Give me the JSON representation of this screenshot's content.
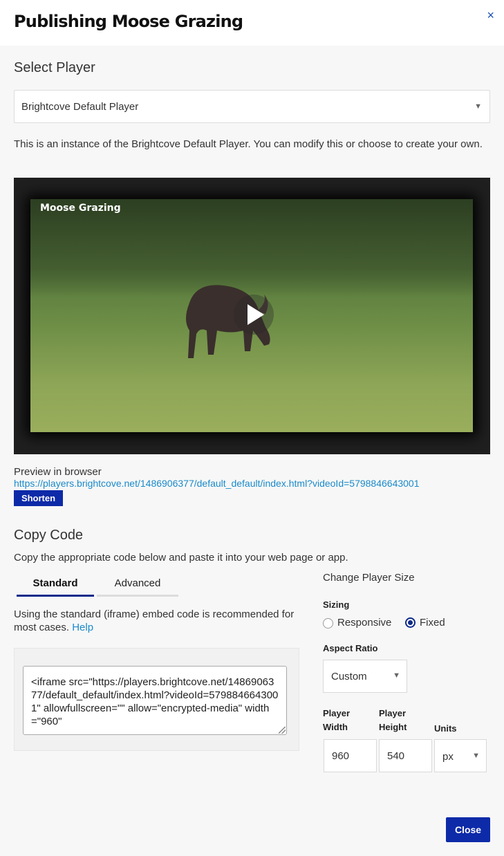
{
  "modal": {
    "title": "Publishing Moose Grazing",
    "close_icon": "×"
  },
  "select_player": {
    "heading": "Select Player",
    "selected": "Brightcove Default Player",
    "description": "This is an instance of the Brightcove Default Player. You can modify this or choose to create your own."
  },
  "player": {
    "video_title": "Moose Grazing",
    "play_icon": "play-icon"
  },
  "preview": {
    "label": "Preview in browser",
    "url": "https://players.brightcove.net/1486906377/default_default/index.html?videoId=5798846643001",
    "shorten_label": "Shorten"
  },
  "copy_code": {
    "heading": "Copy Code",
    "description": "Copy the appropriate code below and paste it into your web page or app.",
    "tabs": [
      "Standard",
      "Advanced"
    ],
    "active_tab": "Standard",
    "standard_note": "Using the standard (iframe) embed code is recommended for most cases.",
    "help_label": "Help",
    "embed_code": "<iframe src=\"https://players.brightcove.net/1486906377/default_default/index.html?videoId=5798846643001\" allowfullscreen=\"\" allow=\"encrypted-media\" width=\"960\""
  },
  "player_size": {
    "heading": "Change Player Size",
    "sizing_label": "Sizing",
    "sizing_options": [
      "Responsive",
      "Fixed"
    ],
    "sizing_selected": "Fixed",
    "aspect_ratio_label": "Aspect Ratio",
    "aspect_ratio": "Custom",
    "width_label": "Player Width",
    "height_label": "Player Height",
    "units_label": "Units",
    "width_value": "960",
    "height_value": "540",
    "units_value": "px"
  },
  "footer": {
    "close_label": "Close"
  },
  "colors": {
    "accent": "#0d2aa8",
    "link": "#1a8ac9"
  }
}
